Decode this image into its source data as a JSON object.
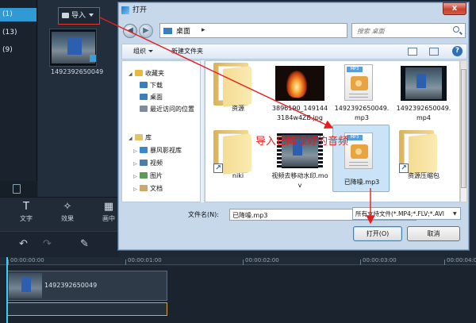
{
  "editor": {
    "library_items": [
      "(1)",
      "(13)",
      "(9)"
    ],
    "import_button": "导入",
    "media_item_name": "1492392650049",
    "tools": [
      {
        "label": "文字",
        "glyph": "T",
        "icon": "text-icon"
      },
      {
        "label": "效果",
        "glyph": "✧",
        "icon": "magic-wand-icon"
      },
      {
        "label": "画中",
        "glyph": "▦",
        "icon": "pip-icon"
      }
    ],
    "timeline_ticks": [
      "00:00:00:00",
      "00:00:01:00",
      "00:00:02:00",
      "00:00:03:00",
      "00:00:04:00"
    ],
    "clip_name": "1492392650049"
  },
  "dialog": {
    "title": "打开",
    "close_glyph": "x",
    "address": "桌面",
    "search_placeholder": "搜索 桌面",
    "toolbar": {
      "organize": "组织",
      "new_folder": "新建文件夹"
    },
    "nav_items": [
      {
        "label": "收藏夹",
        "level": 0,
        "icon": "star-icon",
        "color": "#e8b93a"
      },
      {
        "label": "下载",
        "level": 1,
        "icon": "download-folder-icon",
        "color": "#3c7ebd"
      },
      {
        "label": "桌面",
        "level": 1,
        "icon": "desktop-icon",
        "color": "#3c7ebd"
      },
      {
        "label": "最近访问的位置",
        "level": 1,
        "icon": "recent-places-icon",
        "color": "#7e8b98"
      },
      {
        "label": "库",
        "level": 0,
        "icon": "library-icon",
        "color": "#e3c26c"
      },
      {
        "label": "暴风影视库",
        "level": 1,
        "icon": "video-library-icon",
        "color": "#3a86cf"
      },
      {
        "label": "视频",
        "level": 1,
        "icon": "videos-folder-icon",
        "color": "#4d7ea8"
      },
      {
        "label": "图片",
        "level": 1,
        "icon": "pictures-folder-icon",
        "color": "#5a9b5a"
      },
      {
        "label": "文档",
        "level": 1,
        "icon": "documents-folder-icon",
        "color": "#c9a86a"
      }
    ],
    "files": [
      {
        "name": "资源",
        "type": "folder"
      },
      {
        "name": "3896190_1491443184w4ZB.jpg",
        "type": "image"
      },
      {
        "name": "1492392650049.mp3",
        "type": "audio"
      },
      {
        "name": "1492392650049.mp4",
        "type": "video"
      },
      {
        "name": "niki",
        "type": "folder-shortcut"
      },
      {
        "name": "视频去移动水印.mov",
        "type": "video"
      },
      {
        "name": "已降噪.mp3",
        "type": "audio",
        "selected": true
      },
      {
        "name": "资源压缩包",
        "type": "folder-shortcut"
      }
    ],
    "filename_label": "文件名(N):",
    "filename_value": "已降噪.mp3",
    "filetype_value": "所有支持文件(*.MP4;*.FLV;*.AVI",
    "open_button": "打开(O)",
    "cancel_button": "取消"
  },
  "annotation": {
    "text": "导入已降噪好的音频",
    "color": "#e81c1c"
  }
}
